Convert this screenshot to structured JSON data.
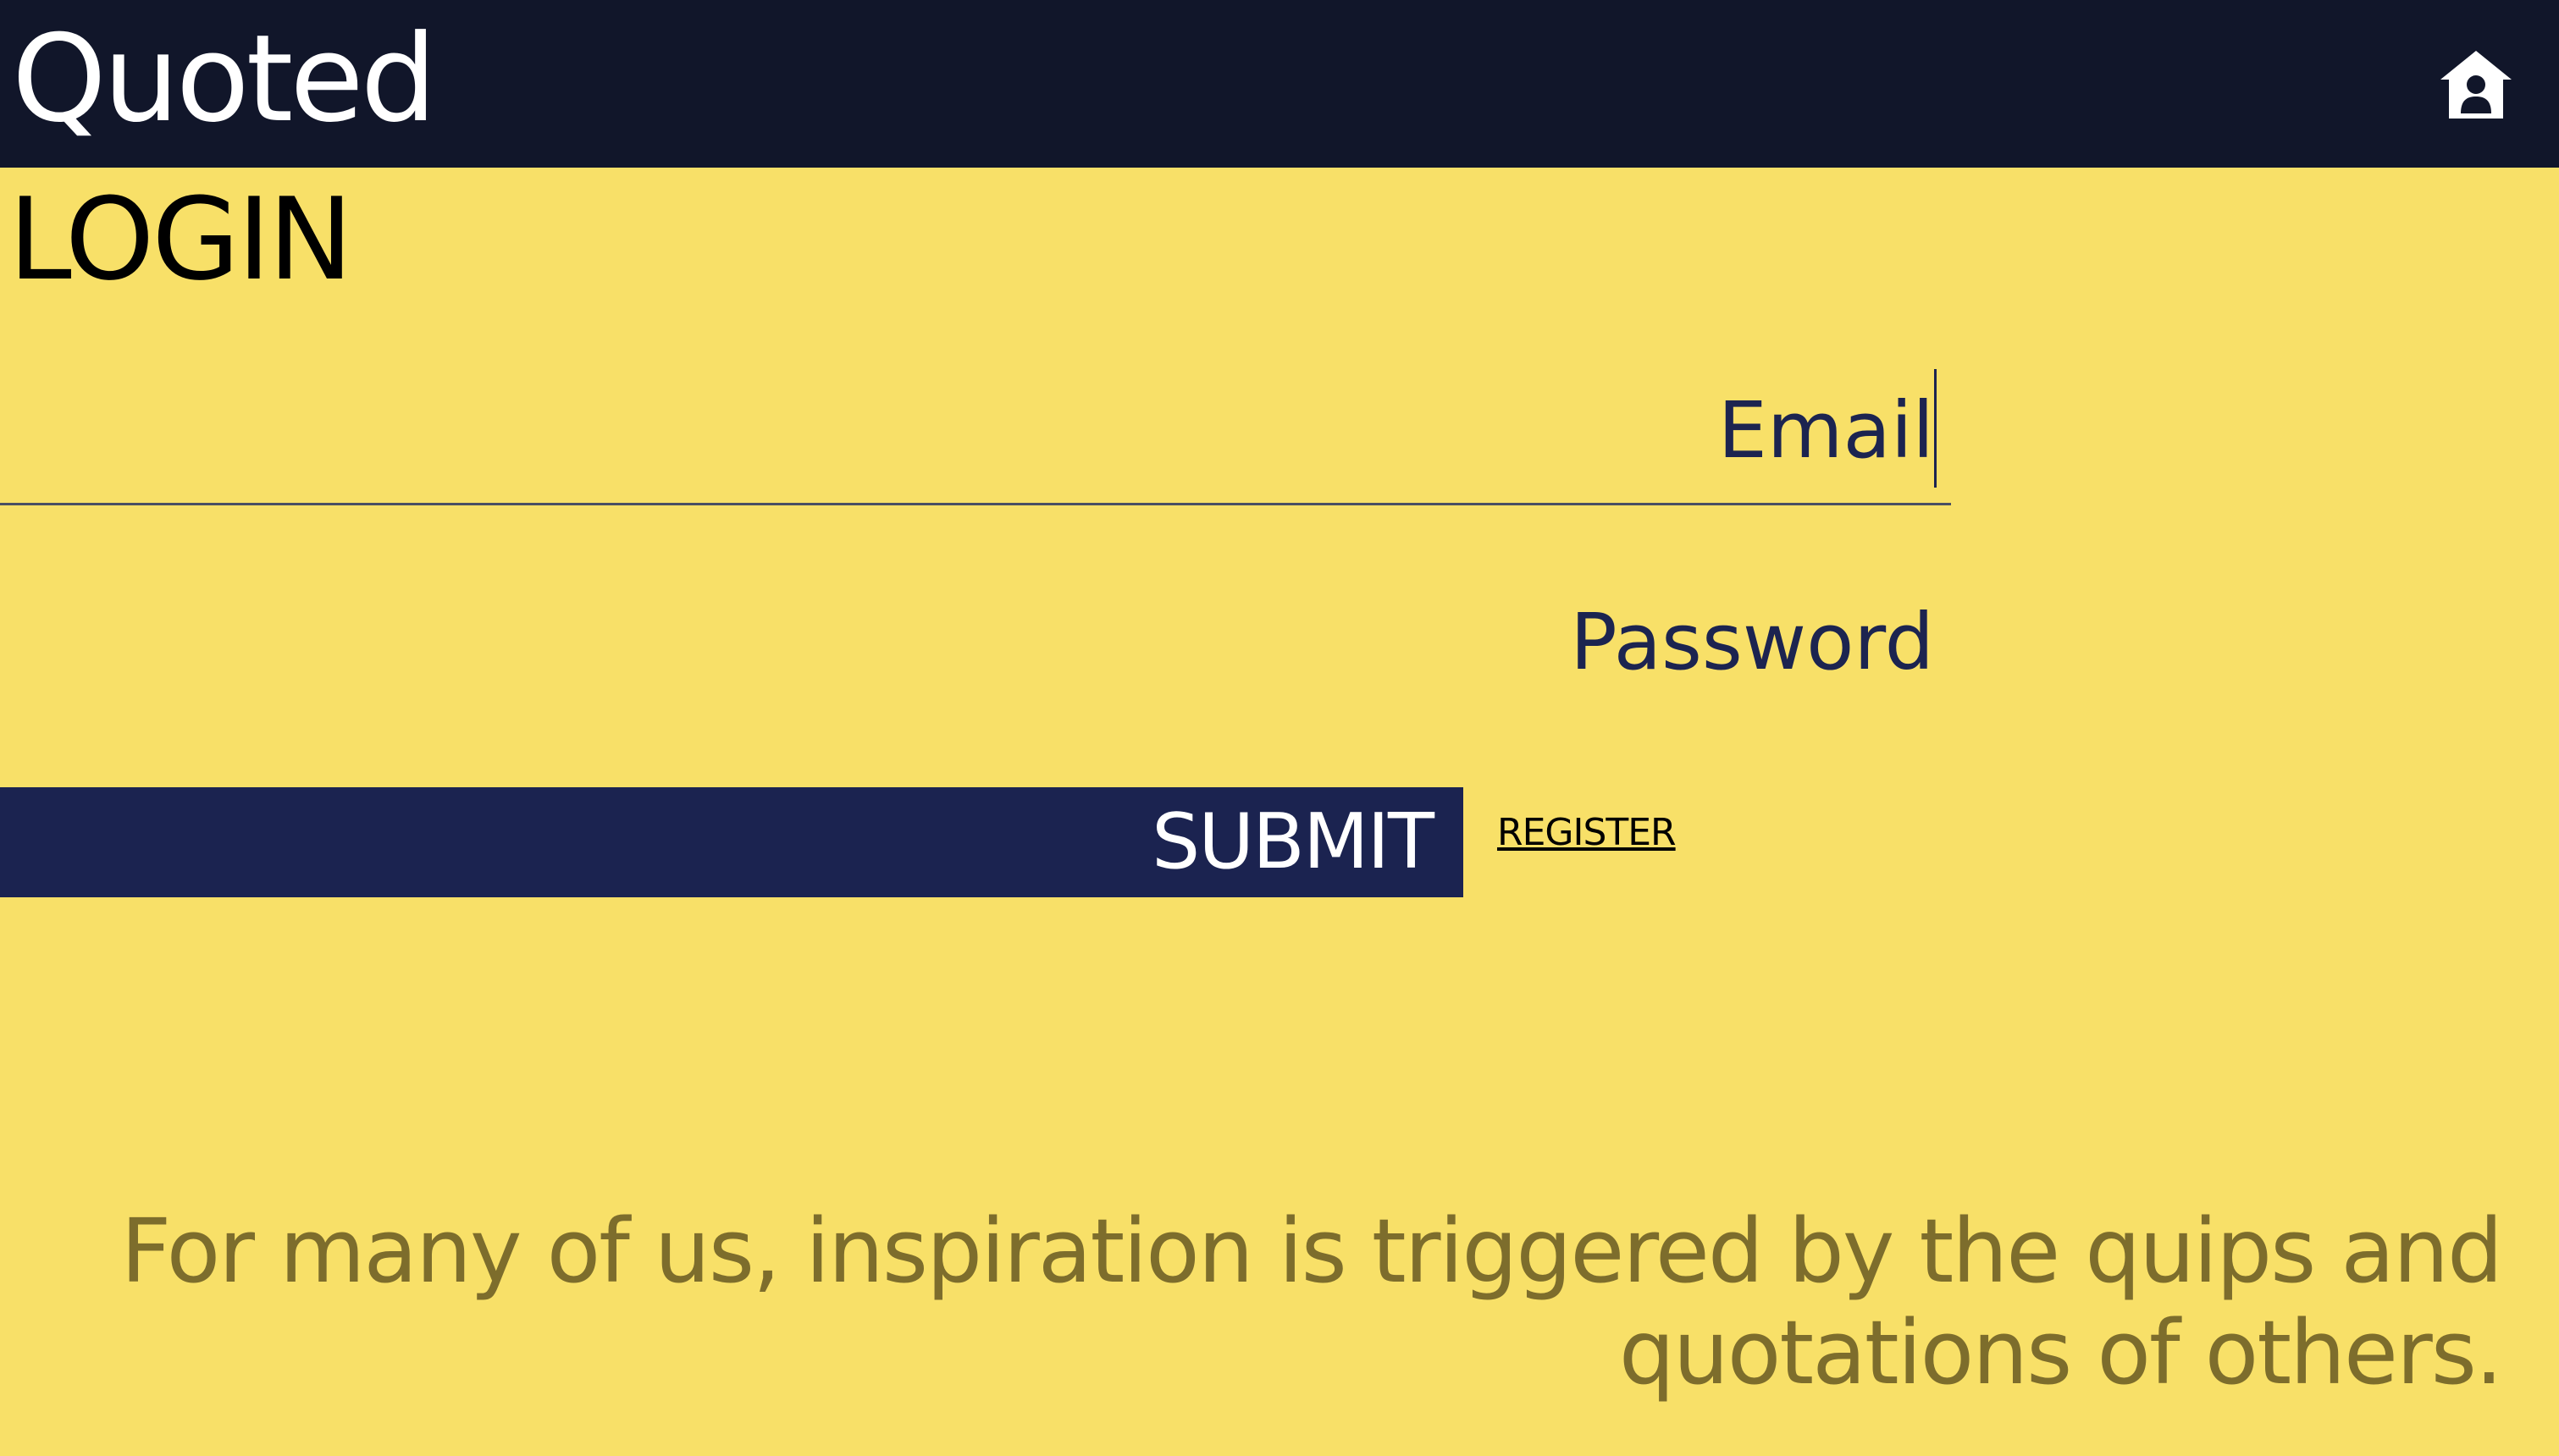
{
  "header": {
    "logo_text": "Quoted",
    "home_icon": "home-user-icon"
  },
  "login": {
    "title": "LOGIN",
    "email_label": "Email",
    "password_label": "Password",
    "submit_label": "SUBMIT",
    "register_label": "REGISTER"
  },
  "footer": {
    "quote": "For many of us, inspiration is triggered by the quips and quotations of others."
  },
  "colors": {
    "background": "#f8e068",
    "header": "#11162a",
    "button": "#1b2350",
    "quote_text": "#7d6d2c"
  }
}
